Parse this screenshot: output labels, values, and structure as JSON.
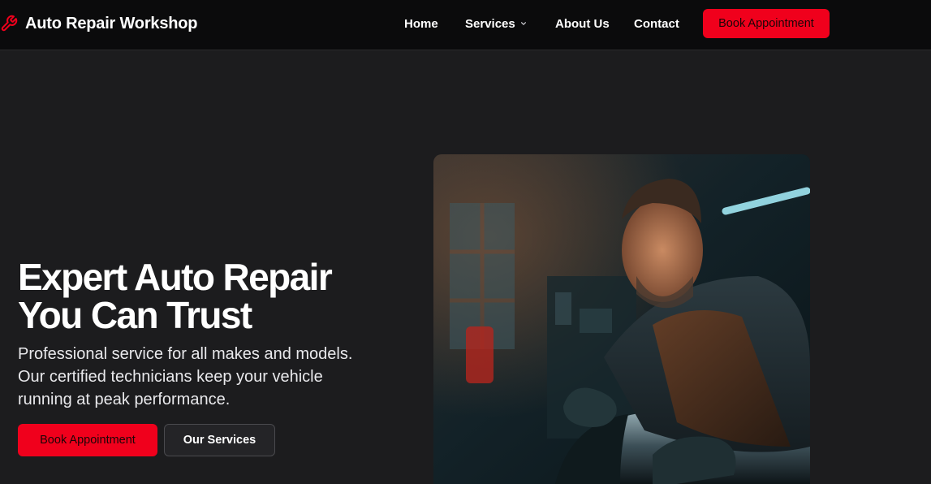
{
  "navbar": {
    "brand_icon": "wrench-icon",
    "brand_name": "Auto Repair Workshop",
    "links": [
      {
        "label": "Home"
      },
      {
        "label": "Services",
        "icon": "chevron-down-icon"
      },
      {
        "label": "About Us"
      },
      {
        "label": "Contact"
      }
    ],
    "cta_label": "Book Appointment"
  },
  "hero": {
    "title_lines": [
      "Expert Auto Repair",
      "You Can Trust"
    ],
    "subtitle_lines": [
      "Professional service for all makes and models.",
      "Our certified technicians keep your vehicle",
      "running at peak performance."
    ],
    "primary_button": "Book Appointment",
    "secondary_button": "Our Services",
    "image_subject": "mechanic working on car engine"
  },
  "colors": {
    "accent": "#f0001c",
    "navbar_bg": "#0b0b0c",
    "page_bg": "#1c1c1e",
    "secondary_button_bg": "#242427"
  }
}
